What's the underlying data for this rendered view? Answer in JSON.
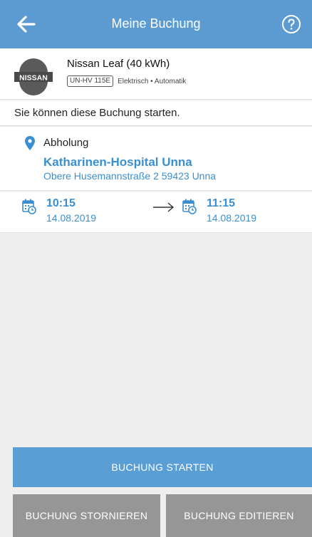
{
  "header": {
    "title": "Meine Buchung",
    "back_icon": "arrow-left-icon",
    "help_icon": "question-circle-icon",
    "bg_color": "#5b9bd2"
  },
  "car": {
    "logo_text": "NISSAN",
    "name": "Nissan Leaf (40 kWh)",
    "plate": "UN-HV 115E",
    "specs": "Elektrisch • Automatik"
  },
  "status": {
    "message": "Sie können diese Buchung starten."
  },
  "pickup": {
    "icon": "map-pin-icon",
    "label": "Abholung",
    "place": "Katharinen-Hospital Unna",
    "address": "Obere Husemannstraße 2 59423 Unna"
  },
  "times": {
    "start": {
      "time": "10:15",
      "date": "14.08.2019"
    },
    "end": {
      "time": "11:15",
      "date": "14.08.2019"
    },
    "calendar_icon": "calendar-clock-icon",
    "accent_color": "#3a8fd0"
  },
  "actions": {
    "start_label": "BUCHUNG STARTEN",
    "cancel_label": "BUCHUNG STORNIEREN",
    "edit_label": "BUCHUNG EDITIEREN"
  }
}
